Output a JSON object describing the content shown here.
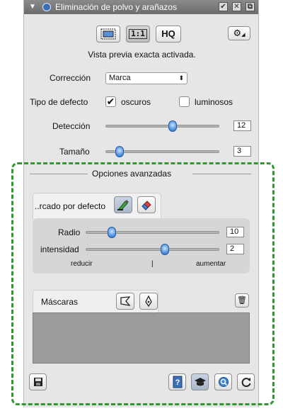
{
  "window": {
    "title": "Eliminación de polvo y arañazos",
    "buttons": [
      "✔",
      "✕",
      "⧉"
    ]
  },
  "preview": {
    "btn_fit_icon": "fit-frame-icon",
    "btn_actual_label": "1:1",
    "btn_hq_label": "HQ",
    "gear_icon": "gear-icon",
    "status": "Vista previa exacta activada."
  },
  "correction": {
    "label": "Corrección",
    "value": "Marca"
  },
  "defect_type": {
    "label": "Tipo de defecto",
    "dark_label": "oscuros",
    "dark_checked": true,
    "light_label": "luminosos",
    "light_checked": false
  },
  "detection": {
    "label": "Detección",
    "value": "12"
  },
  "size": {
    "label": "Tamaño",
    "value": "3"
  },
  "advanced": {
    "title": "Opciones avanzadas",
    "tab_label": "..rcado por defecto",
    "tab_icons": [
      "brush-marker-icon",
      "eraser-icon"
    ],
    "radius": {
      "label": "Radio",
      "value": "10"
    },
    "intensity": {
      "label": "intensidad",
      "value": "2"
    },
    "reduce_label": "reducir",
    "increase_label": "aumentar",
    "masks_label": "Máscaras",
    "mask_icons": [
      "lasso-icon",
      "pen-icon"
    ],
    "trash_icon": "trash-icon"
  },
  "bottom": {
    "save_icon": "save-icon",
    "help_icon": "help-icon",
    "learn_icon": "graduation-cap-icon",
    "zoom_icon": "zoom-icon",
    "reset_icon": "reset-icon"
  }
}
